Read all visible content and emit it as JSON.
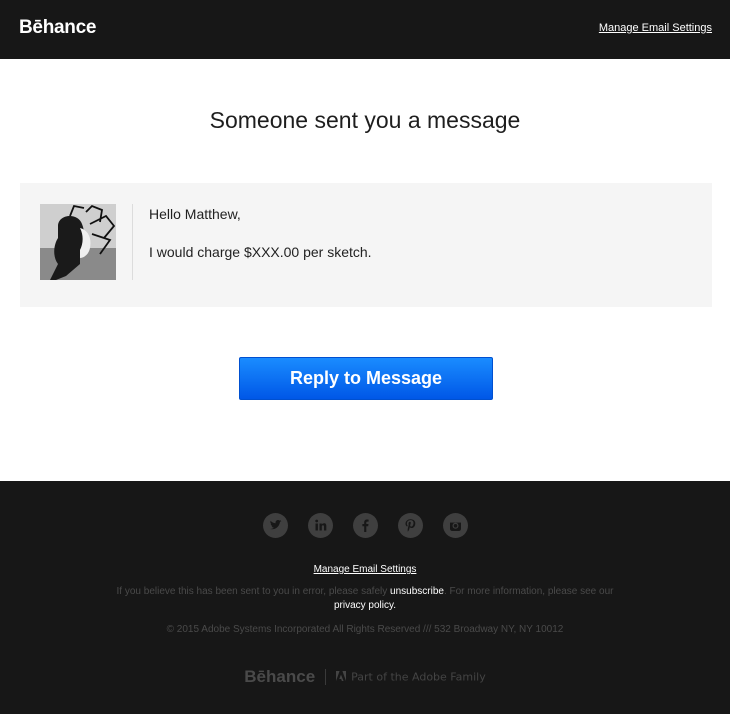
{
  "header": {
    "logo": "Bēhance",
    "manage_link": "Manage Email Settings"
  },
  "main": {
    "title": "Someone sent you a message",
    "message": {
      "greeting": "Hello Matthew,",
      "body": "I would charge $XXX.00 per sketch."
    },
    "reply_button": "Reply to Message"
  },
  "footer": {
    "social_icons": [
      "twitter-icon",
      "linkedin-icon",
      "facebook-icon",
      "pinterest-icon",
      "instagram-icon"
    ],
    "manage_link": "Manage Email Settings",
    "disclaimer_pre": "If you believe this has been sent to you in error, please safely ",
    "unsubscribe": "unsubscribe",
    "disclaimer_mid": ". For more information, please see our ",
    "privacy": "privacy policy",
    "disclaimer_end": ".",
    "copyright": "© 2015 Adobe Systems Incorporated All Rights Reserved /// 532 Broadway NY, NY 10012",
    "brand_logo": "Bēhance",
    "brand_tagline": "Part of the Adobe Family"
  },
  "colors": {
    "header_bg": "#171717",
    "button_blue": "#0a6cf5",
    "message_bg": "#f5f5f5"
  }
}
